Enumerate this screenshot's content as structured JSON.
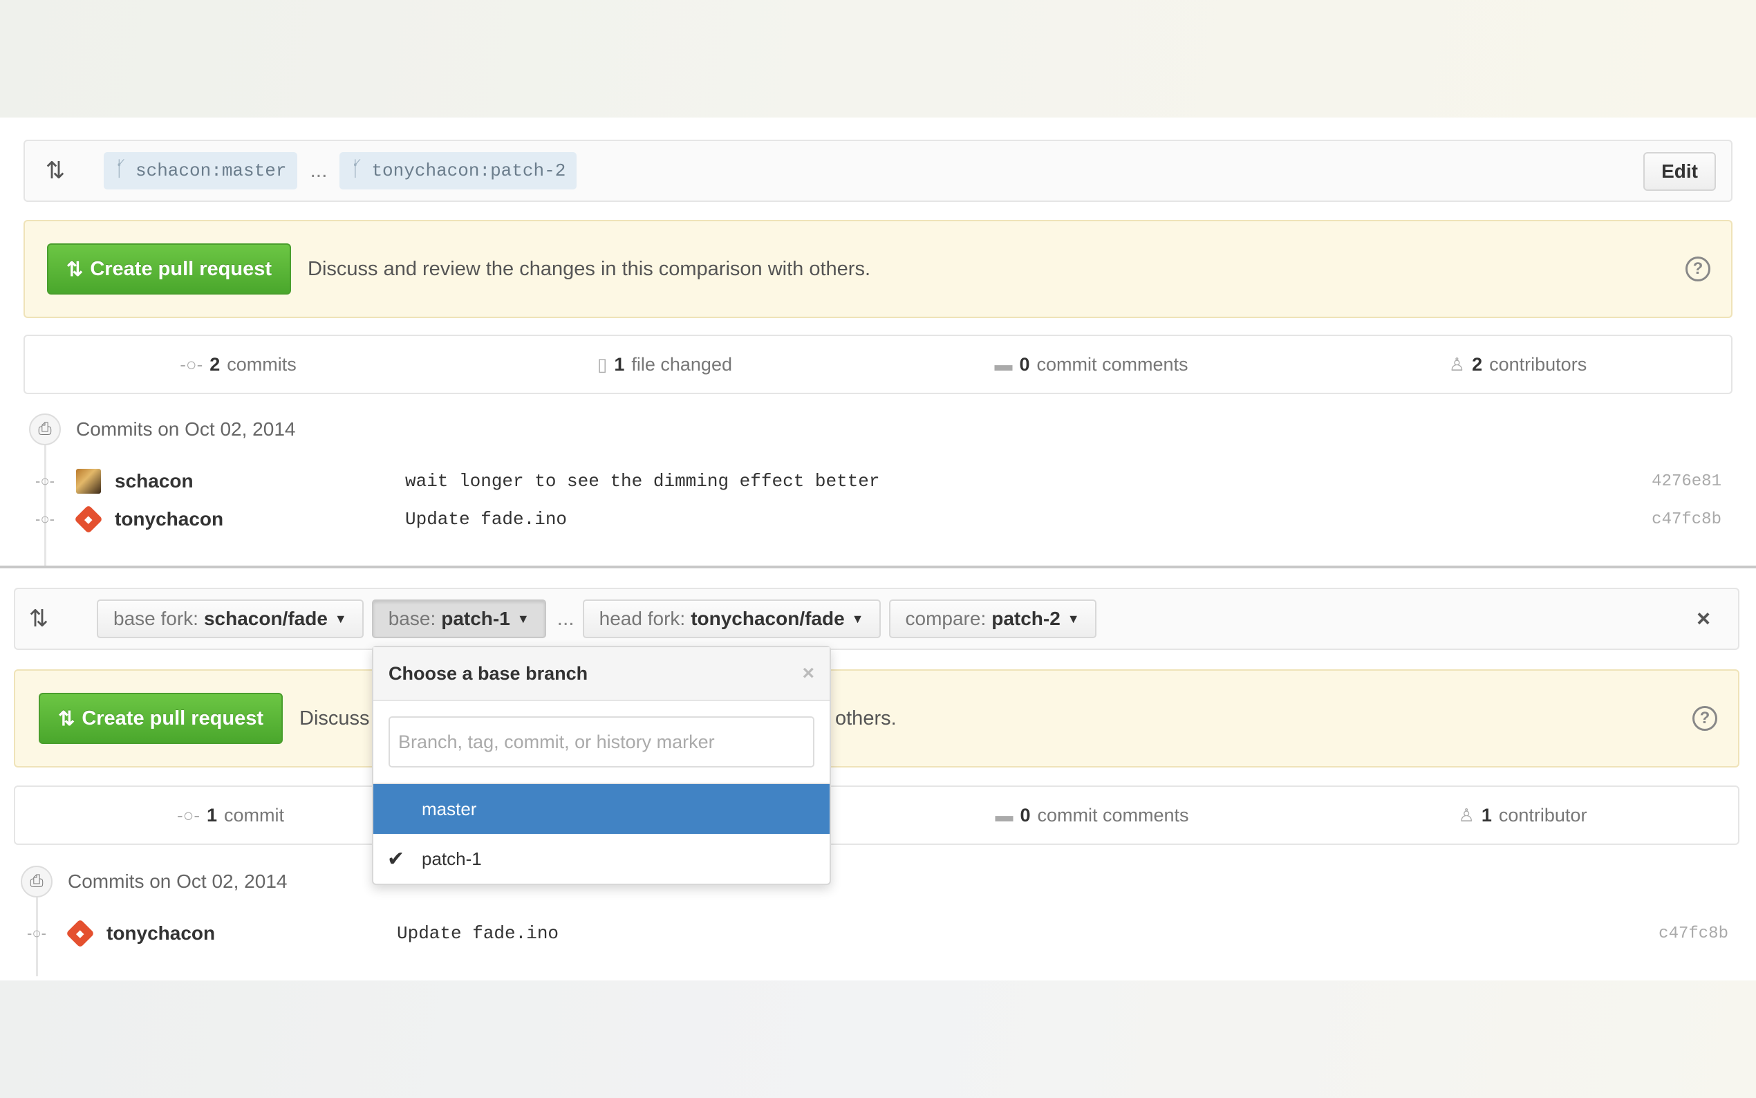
{
  "panel_a": {
    "base_branch": "schacon:master",
    "ellipsis": "...",
    "head_branch": "tonychacon:patch-2",
    "edit_label": "Edit",
    "create_pr_label": "Create pull request",
    "flash_text": "Discuss and review the changes in this comparison with others.",
    "summary": {
      "commits_count": "2",
      "commits_label": "commits",
      "files_count": "1",
      "files_label": "file changed",
      "comments_count": "0",
      "comments_label": "commit comments",
      "contributors_count": "2",
      "contributors_label": "contributors"
    },
    "commit_group_label": "Commits on Oct 02, 2014",
    "commits": [
      {
        "author": "schacon",
        "message": "wait longer to see the dimming effect better",
        "sha": "4276e81"
      },
      {
        "author": "tonychacon",
        "message": "Update fade.ino",
        "sha": "c47fc8b"
      }
    ]
  },
  "panel_b": {
    "base_fork_prefix": "base fork:",
    "base_fork_value": "schacon/fade",
    "base_prefix": "base:",
    "base_value": "patch-1",
    "ellipsis": "...",
    "head_fork_prefix": "head fork:",
    "head_fork_value": "tonychacon/fade",
    "compare_prefix": "compare:",
    "compare_value": "patch-2",
    "close_label": "×",
    "create_pr_label": "Create pull request",
    "flash_text_start": "Discuss",
    "flash_text_end": "others.",
    "summary": {
      "commits_count": "1",
      "commits_label": "commit",
      "comments_count": "0",
      "comments_label": "commit comments",
      "contributors_count": "1",
      "contributors_label": "contributor"
    },
    "commit_group_label": "Commits on Oct 02, 2014",
    "commits": [
      {
        "author": "tonychacon",
        "message": "Update fade.ino",
        "sha": "c47fc8b"
      }
    ],
    "dropdown": {
      "title": "Choose a base branch",
      "close": "×",
      "placeholder": "Branch, tag, commit, or history marker",
      "items": [
        {
          "label": "master",
          "highlighted": true,
          "checked": false
        },
        {
          "label": "patch-1",
          "highlighted": false,
          "checked": true
        }
      ]
    }
  },
  "colors": {
    "green": "#6cc644",
    "highlight_blue": "#4183c4",
    "flash_bg": "#fdf8e4"
  }
}
